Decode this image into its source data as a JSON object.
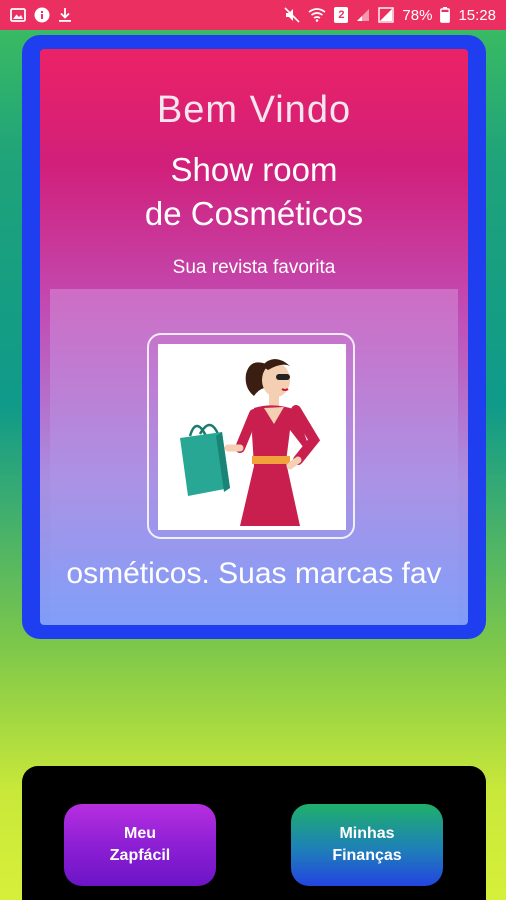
{
  "status_bar": {
    "battery_percent": "78%",
    "time": "15:28",
    "sim_badge": "2",
    "left_icons": [
      "image-icon",
      "info-icon",
      "download-icon"
    ],
    "right_icons": [
      "mute-icon",
      "wifi-icon",
      "sim-icon",
      "signal-icon",
      "signal-icon-2",
      "battery-icon"
    ],
    "color": "#ec2f61"
  },
  "card": {
    "welcome": "Bem Vindo",
    "title_line1": "Show room",
    "title_line2": "de Cosméticos",
    "subtitle": "Sua revista favorita",
    "image": "woman-shopping-illustration",
    "marquee": "osméticos. Suas marcas fav",
    "border_color": "#1f3ef0"
  },
  "bottom": {
    "left_button_line1": "Meu",
    "left_button_line2": "Zapfácil",
    "right_button_line1": "Minhas",
    "right_button_line2": "Finanças"
  }
}
